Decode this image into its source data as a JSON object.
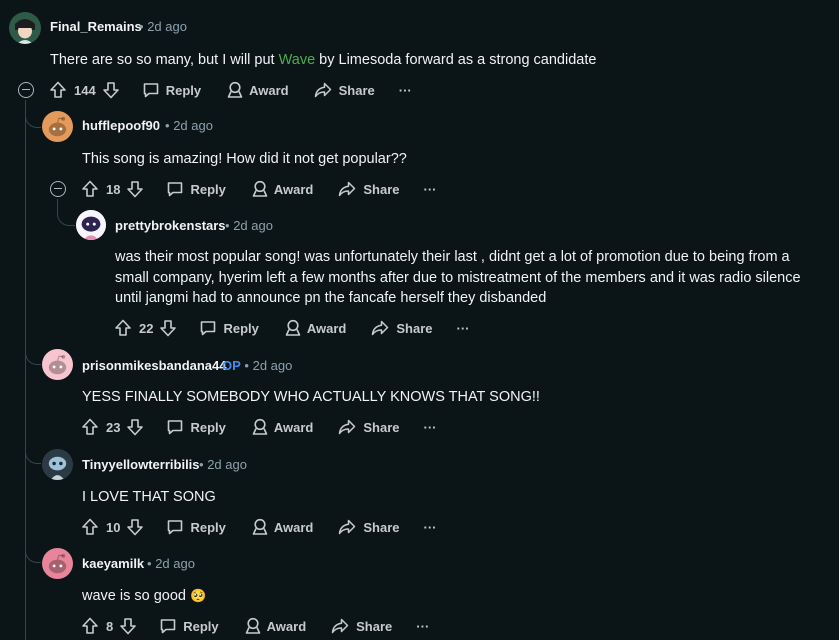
{
  "labels": {
    "reply": "Reply",
    "award": "Award",
    "share": "Share",
    "more": "···",
    "op_badge": "OP",
    "dot": "•"
  },
  "comments": [
    {
      "author": "Final_Remains",
      "time": "2d ago",
      "text_before": "There are so so many, but I will put ",
      "link_text": "Wave",
      "text_after": " by Limesoda forward as a strong candidate",
      "votes": "144",
      "avatar_color": "#1e4a3c",
      "avatar_icon": "character-avatar"
    },
    {
      "author": "hufflepoof90",
      "time": "2d ago",
      "text": "This song is amazing! How did it not get popular??",
      "votes": "18",
      "avatar_color": "#e39a5b",
      "avatar_icon": "snoo-avatar"
    },
    {
      "author": "prettybrokenstars",
      "time": "2d ago",
      "text": "was their most popular song! was unfortunately their last , didnt get a lot of promotion due to being from a small company, hyerim left a few months after due to mistreatment of the members and it was radio silence until jangmi had to announce pn the fancafe herself they disbanded",
      "votes": "22",
      "avatar_color": "#ffffff",
      "avatar_icon": "snoo-avatar"
    },
    {
      "author": "prisonmikesbandana44",
      "is_op": true,
      "time": "2d ago",
      "text": "YESS FINALLY SOMEBODY WHO ACTUALLY KNOWS THAT SONG!!",
      "votes": "23",
      "avatar_color": "#f7c5cf",
      "avatar_icon": "snoo-avatar"
    },
    {
      "author": "Tinyyellowterribilis",
      "time": "2d ago",
      "text": "I LOVE THAT SONG",
      "votes": "10",
      "avatar_color": "#2c3a46",
      "avatar_icon": "snoo-avatar"
    },
    {
      "author": "kaeyamilk",
      "time": "2d ago",
      "text": "wave is so good",
      "emoji": "🥺",
      "votes": "8",
      "avatar_color": "#e8859a",
      "avatar_icon": "snoo-avatar"
    }
  ]
}
